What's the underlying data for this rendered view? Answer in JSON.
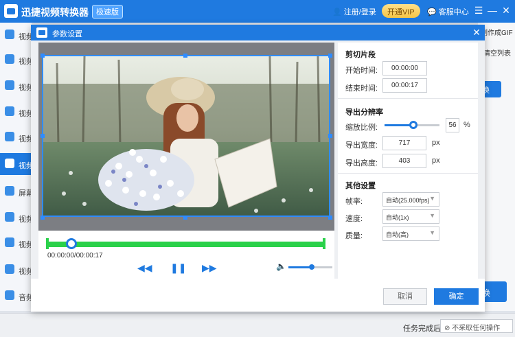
{
  "app": {
    "title": "迅捷视频转换器",
    "badge": "极速版",
    "login": "注册/登录",
    "vip": "开通VIP",
    "service": "客服中心"
  },
  "sidebar": {
    "items": [
      {
        "label": "视频"
      },
      {
        "label": "视频"
      },
      {
        "label": "视频"
      },
      {
        "label": "视频"
      },
      {
        "label": "视频"
      },
      {
        "label": "视频"
      },
      {
        "label": "屏幕"
      },
      {
        "label": "视频"
      },
      {
        "label": "视频"
      },
      {
        "label": "视频"
      },
      {
        "label": "音频"
      }
    ]
  },
  "background": {
    "gif_label": "制作成GIF",
    "clear_label": "清空列表",
    "btn_top": "换",
    "btn_bottom": "换"
  },
  "footer": {
    "label": "任务完成后",
    "select": "不采取任何操作"
  },
  "modal": {
    "title": "参数设置",
    "player": {
      "time": "00:00:00/00:00:17",
      "progress": 0.06,
      "volume": 0.5
    },
    "cut": {
      "title": "剪切片段",
      "start_label": "开始时间:",
      "start_value": "00:00:00",
      "end_label": "结束时间:",
      "end_value": "00:00:17"
    },
    "resolution": {
      "title": "导出分辨率",
      "scale_label": "缩放比例:",
      "scale_value": "56",
      "scale_unit": "%",
      "width_label": "导出宽度:",
      "width_value": "717",
      "height_label": "导出高度:",
      "height_value": "403",
      "px": "px"
    },
    "other": {
      "title": "其他设置",
      "fps_label": "帧率:",
      "fps_value": "自动(25.000fps)",
      "speed_label": "速度:",
      "speed_value": "自动(1x)",
      "quality_label": "质量:",
      "quality_value": "自动(高)"
    },
    "cancel": "取消",
    "ok": "确定"
  }
}
